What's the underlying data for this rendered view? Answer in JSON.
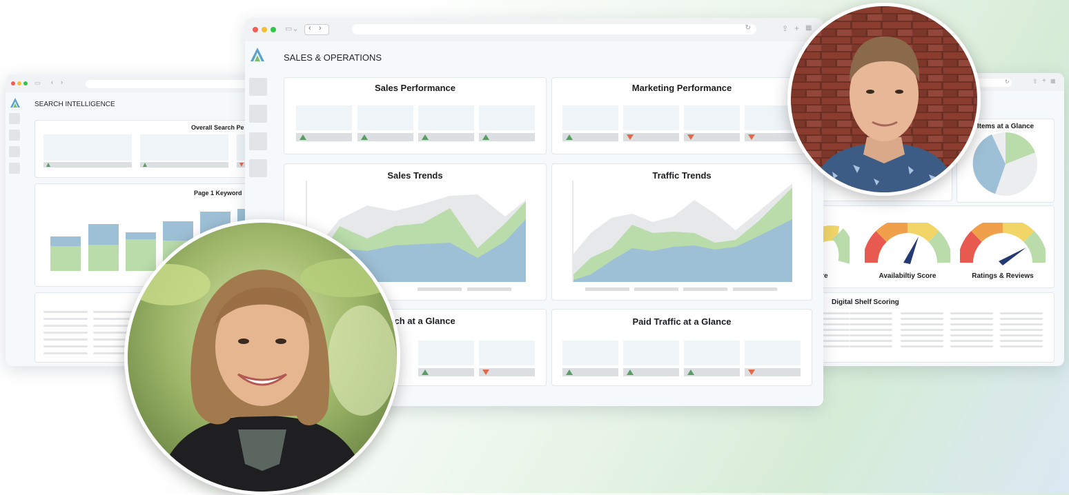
{
  "left_window": {
    "header": "SEARCH INTELLIGENCE",
    "cards": {
      "overall_search": "Overall Search Pe",
      "page1_keywords": "Page 1 Keyword"
    }
  },
  "main_window": {
    "header": "SALES & OPERATIONS",
    "cards": {
      "sales_performance": "Sales Performance",
      "marketing_performance": "Marketing Performance",
      "sales_trends": "Sales Trends",
      "traffic_trends": "Traffic Trends",
      "search_at_a_glance": "Search at a Glance",
      "paid_traffic": "Paid Traffic at a Glance"
    },
    "kpi_trends": {
      "sales_performance": [
        "up",
        "up",
        "up",
        "up"
      ],
      "marketing_performance": [
        "up",
        "down",
        "down",
        "down"
      ],
      "search_at_a_glance": [
        "up",
        "down"
      ],
      "paid_traffic": [
        "up",
        "up",
        "up",
        "down"
      ]
    }
  },
  "right_window": {
    "cards": {
      "items_at_a_glance": "Items at a Glance",
      "partial_score": "ore",
      "availability_score": "Availabiltiy Score",
      "ratings_reviews": "Ratings & Reviews",
      "partial_gauge": "re",
      "digital_shelf": "Digital Shelf Scoring"
    }
  },
  "colors": {
    "accent_green": "#a9d7a2",
    "accent_blue": "#9ec0d6",
    "accent_grey": "#e6e8ea",
    "up": "#5a9e66",
    "down": "#e06a4a",
    "gauge_red": "#e85a4f",
    "gauge_orange": "#f0a04a",
    "gauge_yellow": "#f2d567",
    "gauge_green": "#b9dcaa",
    "needle": "#233a75"
  },
  "icons": [
    "logo-icon",
    "back-chevron-icon",
    "forward-chevron-icon",
    "sidebar-toggle-icon",
    "reload-icon",
    "share-icon",
    "new-tab-icon",
    "tabs-grid-icon"
  ]
}
